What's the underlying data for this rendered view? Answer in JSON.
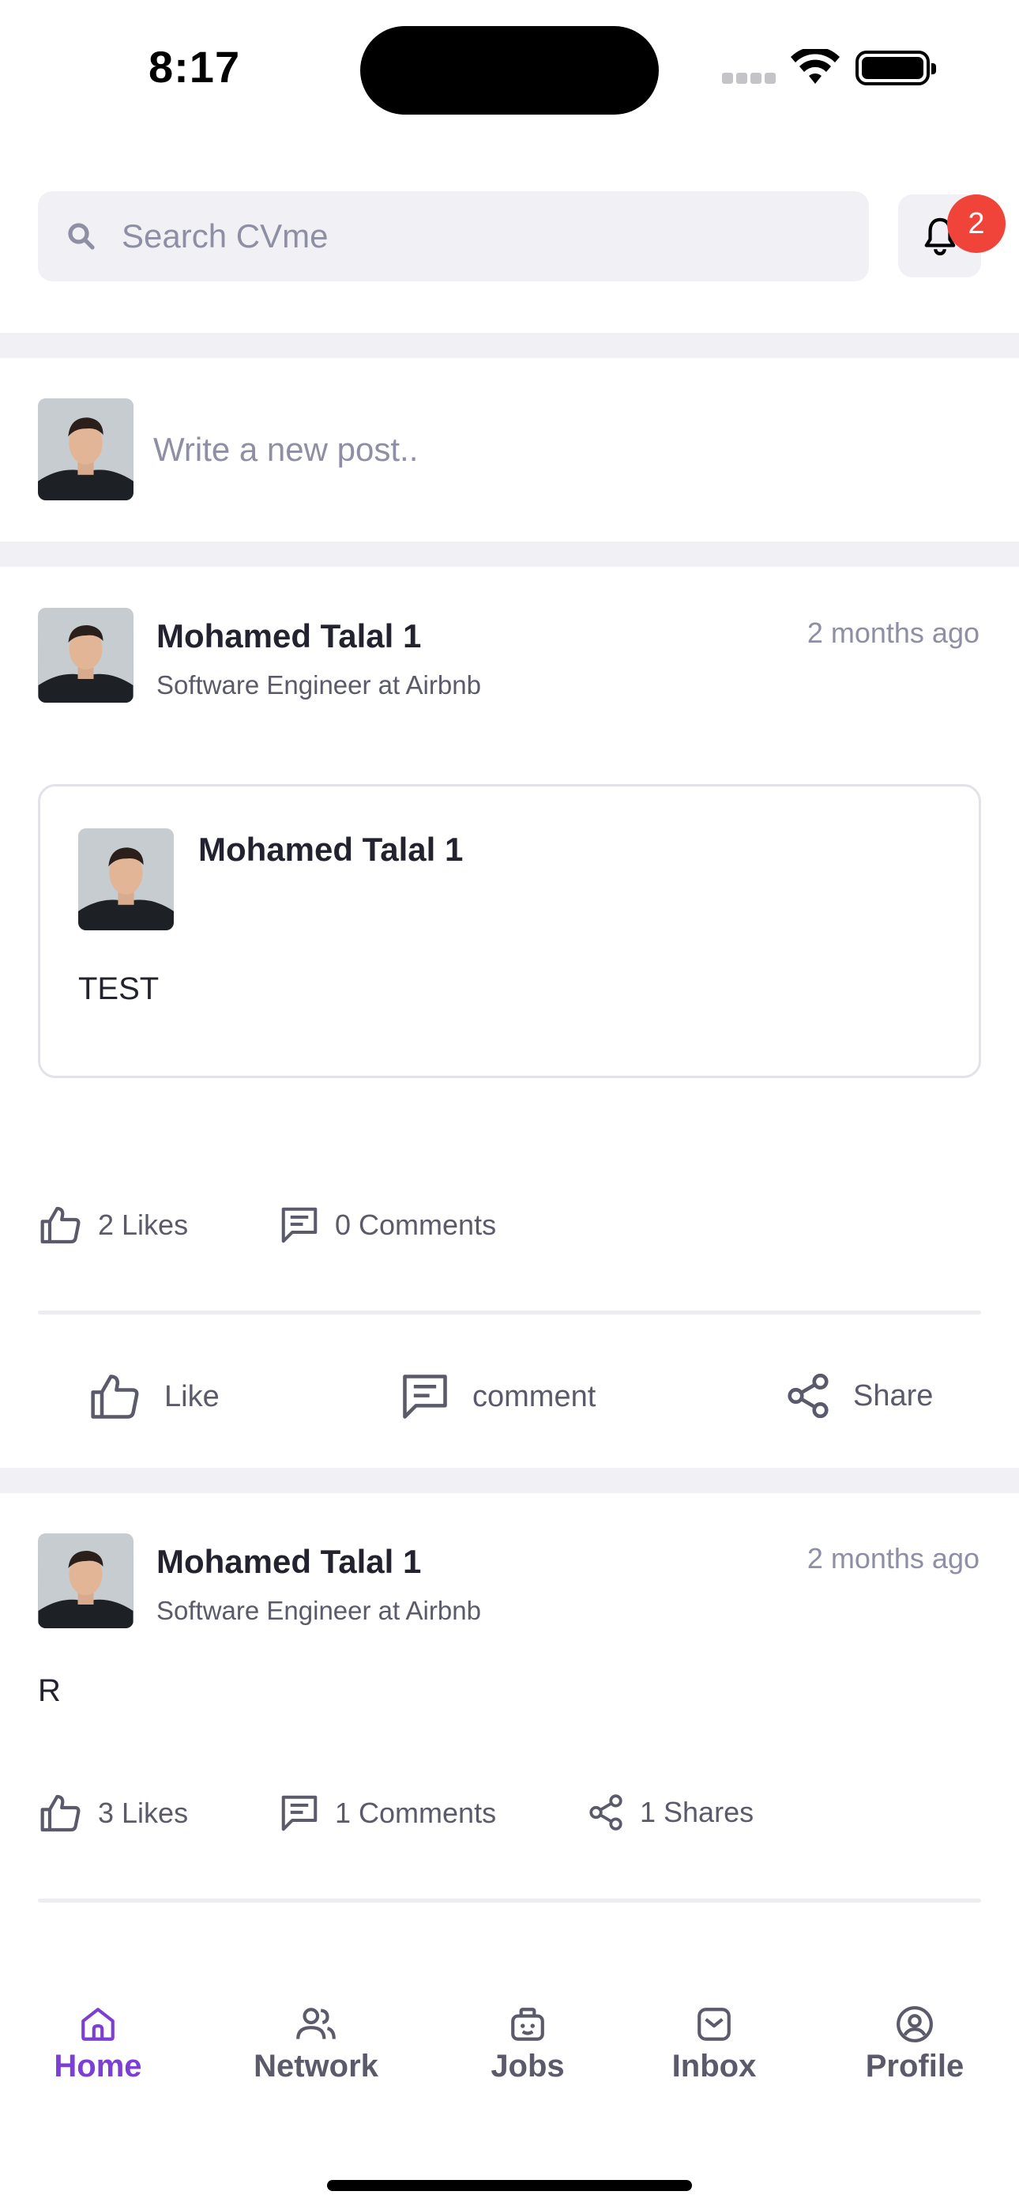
{
  "status_bar": {
    "time": "8:17"
  },
  "search": {
    "placeholder": "Search CVme"
  },
  "notifications": {
    "count": "2"
  },
  "composer": {
    "placeholder": "Write a new post.."
  },
  "posts": [
    {
      "author": "Mohamed Talal 1",
      "headline": "Software Engineer at Airbnb",
      "time_ago": "2 months ago",
      "shared": {
        "author": "Mohamed Talal 1",
        "text": "TEST"
      },
      "stats": {
        "likes": "2 Likes",
        "comments": "0 Comments"
      },
      "actions": {
        "like": "Like",
        "comment": "comment",
        "share": "Share"
      }
    },
    {
      "author": "Mohamed Talal 1",
      "headline": "Software Engineer at Airbnb",
      "time_ago": "2 months ago",
      "text": "R",
      "stats": {
        "likes": "3 Likes",
        "comments": "1 Comments",
        "shares": "1 Shares"
      }
    }
  ],
  "tab_bar": {
    "items": [
      {
        "label": "Home",
        "icon": "home-icon",
        "active": true
      },
      {
        "label": "Network",
        "icon": "people-icon",
        "active": false
      },
      {
        "label": "Jobs",
        "icon": "briefcase-icon",
        "active": false
      },
      {
        "label": "Inbox",
        "icon": "inbox-icon",
        "active": false
      },
      {
        "label": "Profile",
        "icon": "user-circle-icon",
        "active": false
      }
    ]
  },
  "colors": {
    "accent": "#7b3fd6",
    "badge": "#f0433a",
    "muted": "#8e8ea4"
  }
}
